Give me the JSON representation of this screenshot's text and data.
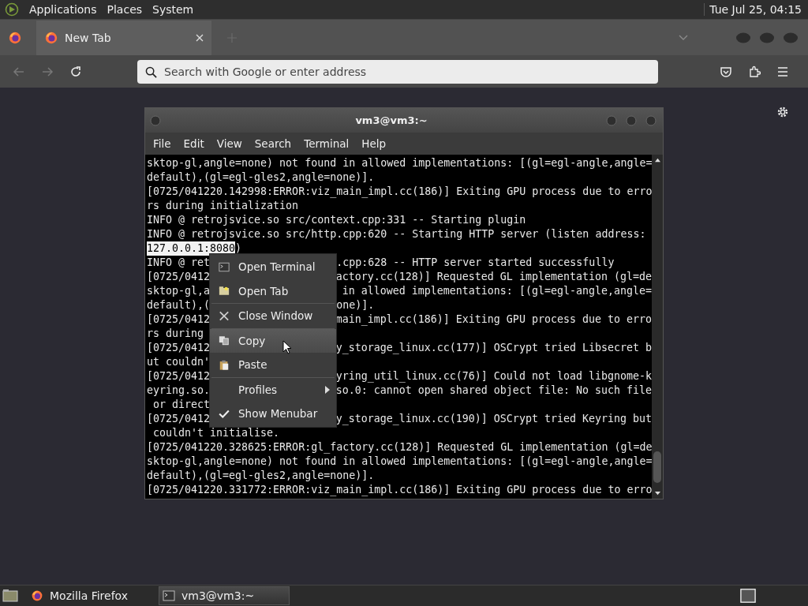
{
  "top_panel": {
    "menus": [
      "Applications",
      "Places",
      "System"
    ],
    "clock": "Tue Jul 25, 04:15"
  },
  "browser": {
    "tabs": [
      {
        "title": "New Tab",
        "selected": true
      }
    ],
    "address_placeholder": "Search with Google or enter address"
  },
  "terminal": {
    "title": "vm3@vm3:~",
    "menu": [
      "File",
      "Edit",
      "View",
      "Search",
      "Terminal",
      "Help"
    ],
    "lines": [
      {
        "text": "sktop-gl,angle=none) not found in allowed implementations: [(gl=egl-angle,angle="
      },
      {
        "text": "default),(gl=egl-gles2,angle=none)]."
      },
      {
        "text": "[0725/041220.142998:ERROR:viz_main_impl.cc(186)] Exiting GPU process due to erro"
      },
      {
        "text": "rs during initialization"
      },
      {
        "text": "INFO @ retrojsvice.so src/context.cpp:331 -- Starting plugin"
      },
      {
        "text": "INFO @ retrojsvice.so src/http.cpp:620 -- Starting HTTP server (listen address:"
      },
      {
        "selection": "127.0.0.1:8080",
        "text": ")"
      },
      {
        "text": "INFO @ ret",
        "right": ".cpp:628 -- HTTP server started successfully"
      },
      {
        "text": "[0725/0412",
        "right": "actory.cc(128)] Requested GL implementation (gl=de"
      },
      {
        "text": "sktop-gl,a",
        "right": " in allowed implementations: [(gl=egl-angle,angle="
      },
      {
        "text": "default),(",
        "right": "one)]."
      },
      {
        "text": "[0725/0412",
        "right": "main_impl.cc(186)] Exiting GPU process due to erro"
      },
      {
        "text": "rs during"
      },
      {
        "text": "[0725/0412",
        "right": "y_storage_linux.cc(177)] OSCrypt tried Libsecret b"
      },
      {
        "text": "ut couldn'"
      },
      {
        "text": "[0725/0412",
        "right": "yring_util_linux.cc(76)] Could not load libgnome-k"
      },
      {
        "text": "eyring.so.",
        "right": "so.0: cannot open shared object file: No such file"
      },
      {
        "text": " or direct"
      },
      {
        "text": "[0725/0412",
        "right": "y_storage_linux.cc(190)] OSCrypt tried Keyring but"
      },
      {
        "text": " couldn't initialise."
      },
      {
        "text": "[0725/041220.328625:ERROR:gl_factory.cc(128)] Requested GL implementation (gl=de"
      },
      {
        "text": "sktop-gl,angle=none) not found in allowed implementations: [(gl=egl-angle,angle="
      },
      {
        "text": "default),(gl=egl-gles2,angle=none)]."
      },
      {
        "text": "[0725/041220.331772:ERROR:viz_main_impl.cc(186)] Exiting GPU process due to erro"
      }
    ],
    "context_menu": [
      {
        "kind": "terminal",
        "label": "Open Terminal",
        "selected": false
      },
      {
        "kind": "tab",
        "label": "Open Tab",
        "selected": false
      },
      {
        "kind": "separator"
      },
      {
        "kind": "close",
        "label": "Close Window",
        "selected": false
      },
      {
        "kind": "separator"
      },
      {
        "kind": "copy",
        "label": "Copy",
        "selected": true
      },
      {
        "kind": "paste",
        "label": "Paste",
        "selected": false
      },
      {
        "kind": "separator"
      },
      {
        "kind": "submenu",
        "label": "Profiles",
        "selected": false
      },
      {
        "kind": "check",
        "label": "Show Menubar",
        "selected": false,
        "checked": true
      }
    ]
  },
  "taskbar": {
    "windows": [
      {
        "label": "Mozilla Firefox",
        "kind": "firefox",
        "selected": false
      },
      {
        "label": "vm3@vm3:~",
        "kind": "terminal",
        "selected": true
      }
    ]
  }
}
